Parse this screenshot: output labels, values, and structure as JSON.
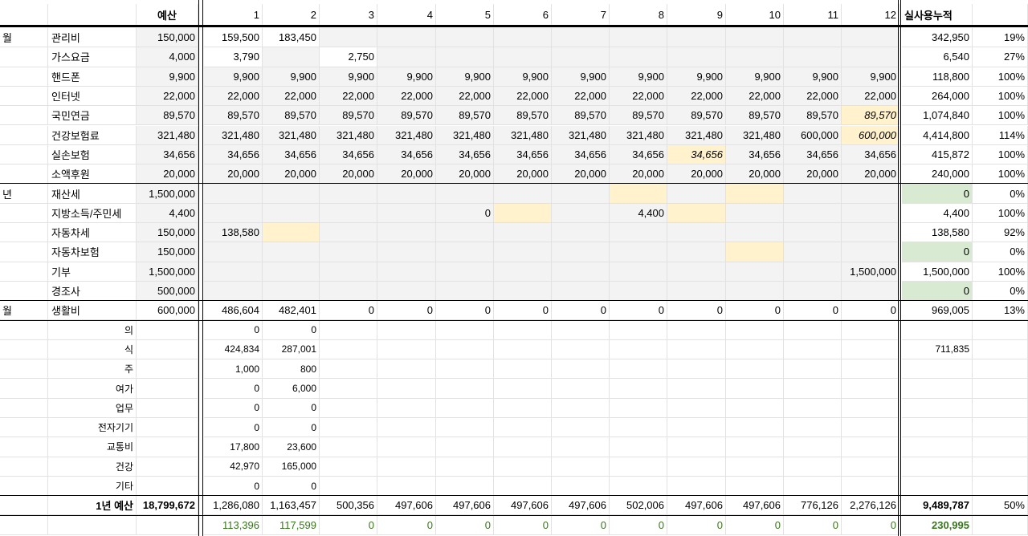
{
  "header": {
    "budget": "예산",
    "months": [
      "1",
      "2",
      "3",
      "4",
      "5",
      "6",
      "7",
      "8",
      "9",
      "10",
      "11",
      "12"
    ],
    "cumulative": "실사용누적"
  },
  "rows": [
    {
      "group": "월",
      "label": "관리비",
      "budget": "150,000",
      "months": [
        "159,500",
        "183,450",
        "",
        "",
        "",
        "",
        "",
        "",
        "",
        "",
        "",
        ""
      ],
      "total": "342,950",
      "pct": "19%"
    },
    {
      "group": "",
      "label": "가스요금",
      "budget": "4,000",
      "months": [
        "3,790",
        "",
        "2,750",
        "",
        "",
        "",
        "",
        "",
        "",
        "",
        "",
        ""
      ],
      "total": "6,540",
      "pct": "27%"
    },
    {
      "group": "",
      "label": "핸드폰",
      "budget": "9,900",
      "months": [
        "9,900",
        "9,900",
        "9,900",
        "9,900",
        "9,900",
        "9,900",
        "9,900",
        "9,900",
        "9,900",
        "9,900",
        "9,900",
        "9,900"
      ],
      "total": "118,800",
      "pct": "100%"
    },
    {
      "group": "",
      "label": "인터넷",
      "budget": "22,000",
      "months": [
        "22,000",
        "22,000",
        "22,000",
        "22,000",
        "22,000",
        "22,000",
        "22,000",
        "22,000",
        "22,000",
        "22,000",
        "22,000",
        "22,000"
      ],
      "total": "264,000",
      "pct": "100%"
    },
    {
      "group": "",
      "label": "국민연금",
      "budget": "89,570",
      "months": [
        "89,570",
        "89,570",
        "89,570",
        "89,570",
        "89,570",
        "89,570",
        "89,570",
        "89,570",
        "89,570",
        "89,570",
        "89,570",
        "89,570"
      ],
      "total": "1,074,840",
      "pct": "100%"
    },
    {
      "group": "",
      "label": "건강보험료",
      "budget": "321,480",
      "months": [
        "321,480",
        "321,480",
        "321,480",
        "321,480",
        "321,480",
        "321,480",
        "321,480",
        "321,480",
        "321,480",
        "321,480",
        "600,000",
        "600,000"
      ],
      "total": "4,414,800",
      "pct": "114%"
    },
    {
      "group": "",
      "label": "실손보험",
      "budget": "34,656",
      "months": [
        "34,656",
        "34,656",
        "34,656",
        "34,656",
        "34,656",
        "34,656",
        "34,656",
        "34,656",
        "34,656",
        "34,656",
        "34,656",
        "34,656"
      ],
      "total": "415,872",
      "pct": "100%"
    },
    {
      "group": "",
      "label": "소액후원",
      "budget": "20,000",
      "months": [
        "20,000",
        "20,000",
        "20,000",
        "20,000",
        "20,000",
        "20,000",
        "20,000",
        "20,000",
        "20,000",
        "20,000",
        "20,000",
        "20,000"
      ],
      "total": "240,000",
      "pct": "100%"
    },
    {
      "group": "년",
      "label": "재산세",
      "budget": "1,500,000",
      "months": [
        "",
        "",
        "",
        "",
        "",
        "",
        "",
        "",
        "",
        "",
        "",
        ""
      ],
      "total": "0",
      "pct": "0%"
    },
    {
      "group": "",
      "label": "지방소득/주민세",
      "budget": "4,400",
      "months": [
        "",
        "",
        "",
        "",
        "0",
        "",
        "",
        "4,400",
        "",
        "",
        "",
        ""
      ],
      "total": "4,400",
      "pct": "100%"
    },
    {
      "group": "",
      "label": "자동차세",
      "budget": "150,000",
      "months": [
        "138,580",
        "",
        "",
        "",
        "",
        "",
        "",
        "",
        "",
        "",
        "",
        ""
      ],
      "total": "138,580",
      "pct": "92%"
    },
    {
      "group": "",
      "label": "자동차보험",
      "budget": "150,000",
      "months": [
        "",
        "",
        "",
        "",
        "",
        "",
        "",
        "",
        "",
        "",
        "",
        ""
      ],
      "total": "0",
      "pct": "0%"
    },
    {
      "group": "",
      "label": "기부",
      "budget": "1,500,000",
      "months": [
        "",
        "",
        "",
        "",
        "",
        "",
        "",
        "",
        "",
        "",
        "",
        "1,500,000"
      ],
      "total": "1,500,000",
      "pct": "100%"
    },
    {
      "group": "",
      "label": "경조사",
      "budget": "500,000",
      "months": [
        "",
        "",
        "",
        "",
        "",
        "",
        "",
        "",
        "",
        "",
        "",
        ""
      ],
      "total": "0",
      "pct": "0%"
    },
    {
      "group": "월",
      "label": "생활비",
      "budget": "600,000",
      "months": [
        "486,604",
        "482,401",
        "0",
        "0",
        "0",
        "0",
        "0",
        "0",
        "0",
        "0",
        "0",
        "0"
      ],
      "total": "969,005",
      "pct": "13%"
    },
    {
      "group": "",
      "label": "의",
      "budget": "",
      "months": [
        "0",
        "0",
        "",
        "",
        "",
        "",
        "",
        "",
        "",
        "",
        "",
        ""
      ],
      "total": "",
      "pct": ""
    },
    {
      "group": "",
      "label": "식",
      "budget": "",
      "months": [
        "424,834",
        "287,001",
        "",
        "",
        "",
        "",
        "",
        "",
        "",
        "",
        "",
        ""
      ],
      "total": "711,835",
      "pct": ""
    },
    {
      "group": "",
      "label": "주",
      "budget": "",
      "months": [
        "1,000",
        "800",
        "",
        "",
        "",
        "",
        "",
        "",
        "",
        "",
        "",
        ""
      ],
      "total": "",
      "pct": ""
    },
    {
      "group": "",
      "label": "여가",
      "budget": "",
      "months": [
        "0",
        "6,000",
        "",
        "",
        "",
        "",
        "",
        "",
        "",
        "",
        "",
        ""
      ],
      "total": "",
      "pct": ""
    },
    {
      "group": "",
      "label": "업무",
      "budget": "",
      "months": [
        "0",
        "0",
        "",
        "",
        "",
        "",
        "",
        "",
        "",
        "",
        "",
        ""
      ],
      "total": "",
      "pct": ""
    },
    {
      "group": "",
      "label": "전자기기",
      "budget": "",
      "months": [
        "0",
        "0",
        "",
        "",
        "",
        "",
        "",
        "",
        "",
        "",
        "",
        ""
      ],
      "total": "",
      "pct": ""
    },
    {
      "group": "",
      "label": "교통비",
      "budget": "",
      "months": [
        "17,800",
        "23,600",
        "",
        "",
        "",
        "",
        "",
        "",
        "",
        "",
        "",
        ""
      ],
      "total": "",
      "pct": ""
    },
    {
      "group": "",
      "label": "건강",
      "budget": "",
      "months": [
        "42,970",
        "165,000",
        "",
        "",
        "",
        "",
        "",
        "",
        "",
        "",
        "",
        ""
      ],
      "total": "",
      "pct": ""
    },
    {
      "group": "",
      "label": "기타",
      "budget": "",
      "months": [
        "0",
        "0",
        "",
        "",
        "",
        "",
        "",
        "",
        "",
        "",
        "",
        ""
      ],
      "total": "",
      "pct": ""
    },
    {
      "group": "",
      "label": "1년 예산",
      "budget": "18,799,672",
      "months": [
        "1,286,080",
        "1,163,457",
        "500,356",
        "497,606",
        "497,606",
        "497,606",
        "497,606",
        "502,006",
        "497,606",
        "497,606",
        "776,126",
        "2,276,126"
      ],
      "total": "9,489,787",
      "pct": "50%"
    },
    {
      "group": "",
      "label": "",
      "budget": "",
      "months": [
        "113,396",
        "117,599",
        "0",
        "0",
        "0",
        "0",
        "0",
        "0",
        "0",
        "0",
        "0",
        "0"
      ],
      "total": "230,995",
      "pct": ""
    }
  ],
  "colors": {
    "gray_fill": "#f3f3f3",
    "yellow_highlight": "#fff2cc",
    "green_highlight": "#d9ead3",
    "green_text": "#38761d",
    "grid": "#e2e2e2"
  }
}
